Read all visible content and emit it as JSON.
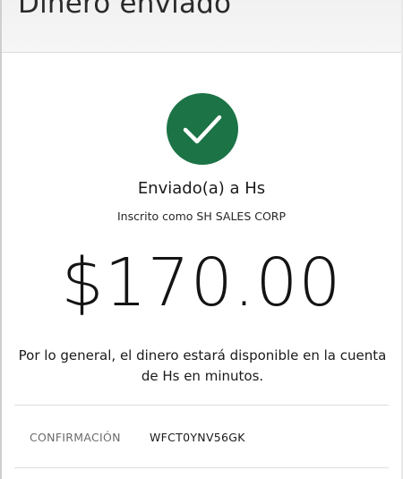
{
  "header": {
    "title": "Dinero enviado"
  },
  "status": {
    "icon": "checkmark-icon",
    "color": "#1b7346"
  },
  "transfer": {
    "recipient_line": "Enviado(a) a Hs",
    "registered_line": "Inscrito como SH SALES CORP",
    "amount": "$170.00",
    "availability_note": "Por lo general, el dinero estará disponible en la cuenta de Hs en minutos."
  },
  "confirmation": {
    "label": "CONFIRMACIÓN",
    "value": "WFCT0YNV56GK"
  }
}
